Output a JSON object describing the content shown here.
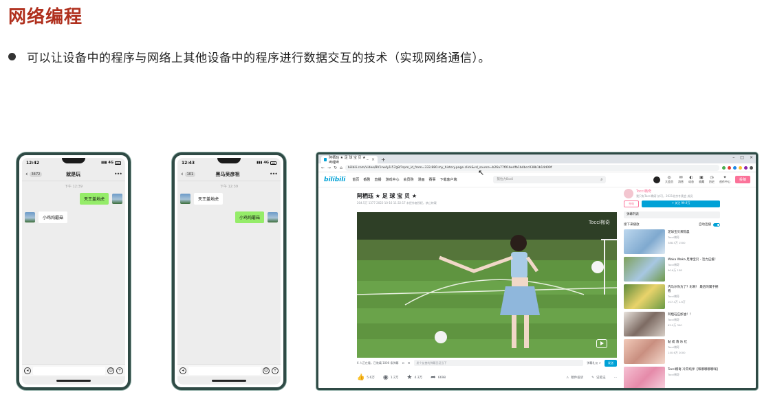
{
  "slide": {
    "title": "网络编程",
    "bullet": "可以让设备中的程序与网络上其他设备中的程序进行数据交互的技术（实现网络通信）。"
  },
  "phones": [
    {
      "time": "12:42",
      "signal": "4G",
      "badge": "3472",
      "chat_name": "就是玩",
      "timestamp": "下午 12:39",
      "messages": [
        {
          "side": "right",
          "text": "天王盖地虎"
        },
        {
          "side": "left",
          "text": "小鸡炖蘑菇"
        }
      ]
    },
    {
      "time": "12:43",
      "signal": "4G",
      "badge": "101",
      "chat_name": "黑马吴彦祖",
      "timestamp": "下午 12:39",
      "messages": [
        {
          "side": "left",
          "text": "天王盖地虎"
        },
        {
          "side": "right",
          "text": "小鸡炖蘑菇"
        }
      ]
    }
  ],
  "browser": {
    "tab_title": "阿栖珏 ★ 足 球 宝 贝 ★ _哔哩哔",
    "url": "bilibili.com/video/BV1rw4y1i57g8/?spm_id_from=333.880.my_history.page.click&vd_source=b26a77f01be4fb1b4bcc038b1b14d09f",
    "site": {
      "logo": "bilibili",
      "nav": [
        "首页",
        "番剧",
        "直播",
        "游戏中心",
        "会员购",
        "漫画",
        "赛事",
        "下载客户端"
      ],
      "search_placeholder": "鼓拉力Bodi",
      "menu": [
        "大会员",
        "消息",
        "动态",
        "收藏",
        "历史",
        "创作中心"
      ],
      "upload": "投稿"
    },
    "video": {
      "title": "阿栖珏 ★ 足 球 宝 贝 ★",
      "meta": "204.5万   1377   2022-10-16 11:32:17   未经作者授权，禁止转载",
      "watermark": "Tocci椭奇",
      "danmaku_info": "6 人正在看，已装填 1000 条弹幕",
      "danmaku_placeholder": "发个友善的弹幕见证当下",
      "danmaku_etiquette": "弹幕礼仪 >",
      "send": "发送",
      "likes": "5.6万",
      "coins": "1.2万",
      "favorites": "4.3万",
      "shares": "6698",
      "report": "稿件投诉",
      "notes": "记笔记"
    },
    "sidebar": {
      "up_name": "Tocci椭奇",
      "up_desc": "我只有Tocci椭奇 妙可，2021北京冬奥会 成员",
      "charge": "充电",
      "follow": "+ 关注 99.9万",
      "danmaku_list": "弹幕列表",
      "next_play": "接下来播放",
      "autoplay": "自动连播",
      "recommendations": [
        {
          "title": "足球宝贝来陈晨",
          "author": "Tocci椭奇",
          "stats": "388.5万  1500"
        },
        {
          "title": "Waka Waka 足球宝贝 - 活力应援！",
          "author": "Tocci椭奇",
          "stats": "90.6万  158"
        },
        {
          "title": "内马尔你为了？彩啊！ 最后的属于拥看",
          "author": "Tocci椭奇",
          "stats": "107.4万  1.6万"
        },
        {
          "title": "阿栖珏应加油！！",
          "author": "Tocci椭奇",
          "stats": "62.9万  300"
        },
        {
          "title": "黏 成 落 乐 红",
          "author": "Tocci椭奇",
          "stats": "140.6万  2000"
        },
        {
          "title": "Tocci椭奇 冷开纯享【和哪哪哪哪咪】",
          "author": "Tocci椭奇",
          "stats": ""
        }
      ]
    }
  }
}
